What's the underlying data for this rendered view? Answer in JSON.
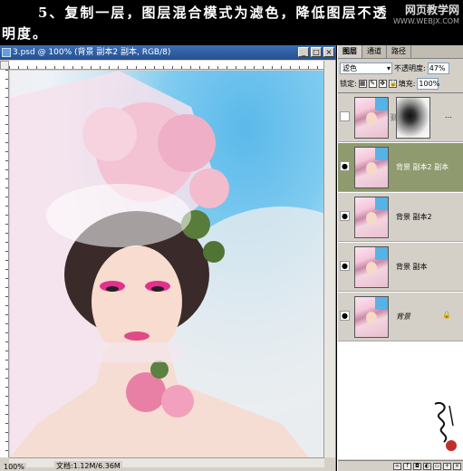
{
  "instruction": {
    "line1": "5、复制一层，图层混合模式为滤色，降低图层不透",
    "line2": "明度。"
  },
  "watermark": {
    "site_cn": "网页教学网",
    "site_url": "WWW.WEBJX.COM"
  },
  "document": {
    "title": "3.psd @ 100% (背景 副本2 副本, RGB/8)",
    "zoom": "100%",
    "doc_info": "文档:1.12M/6.36M",
    "window_buttons": [
      "minimize",
      "maximize",
      "close"
    ]
  },
  "layers_panel": {
    "tabs": [
      {
        "label": "图层",
        "active": true
      },
      {
        "label": "通道",
        "active": false
      },
      {
        "label": "路径",
        "active": false
      }
    ],
    "blend_mode": "滤色",
    "opacity_label": "不透明度:",
    "opacity_value": "47%",
    "lock_label": "锁定:",
    "fill_label": "填充:",
    "fill_value": "100%",
    "layers": [
      {
        "name": "",
        "has_mask": true,
        "visible": false,
        "selected": false
      },
      {
        "name": "背景 副本2 副本",
        "has_mask": false,
        "visible": true,
        "selected": true
      },
      {
        "name": "背景 副本2",
        "has_mask": false,
        "visible": true,
        "selected": false
      },
      {
        "name": "背景 副本",
        "has_mask": false,
        "visible": true,
        "selected": false
      },
      {
        "name": "背景",
        "has_mask": false,
        "visible": true,
        "selected": false,
        "locked": true
      }
    ]
  },
  "colors": {
    "selected_layer": "#8f9a6e",
    "titlebar": "#2f5fa5",
    "ui_gray": "#d4d0c8"
  }
}
